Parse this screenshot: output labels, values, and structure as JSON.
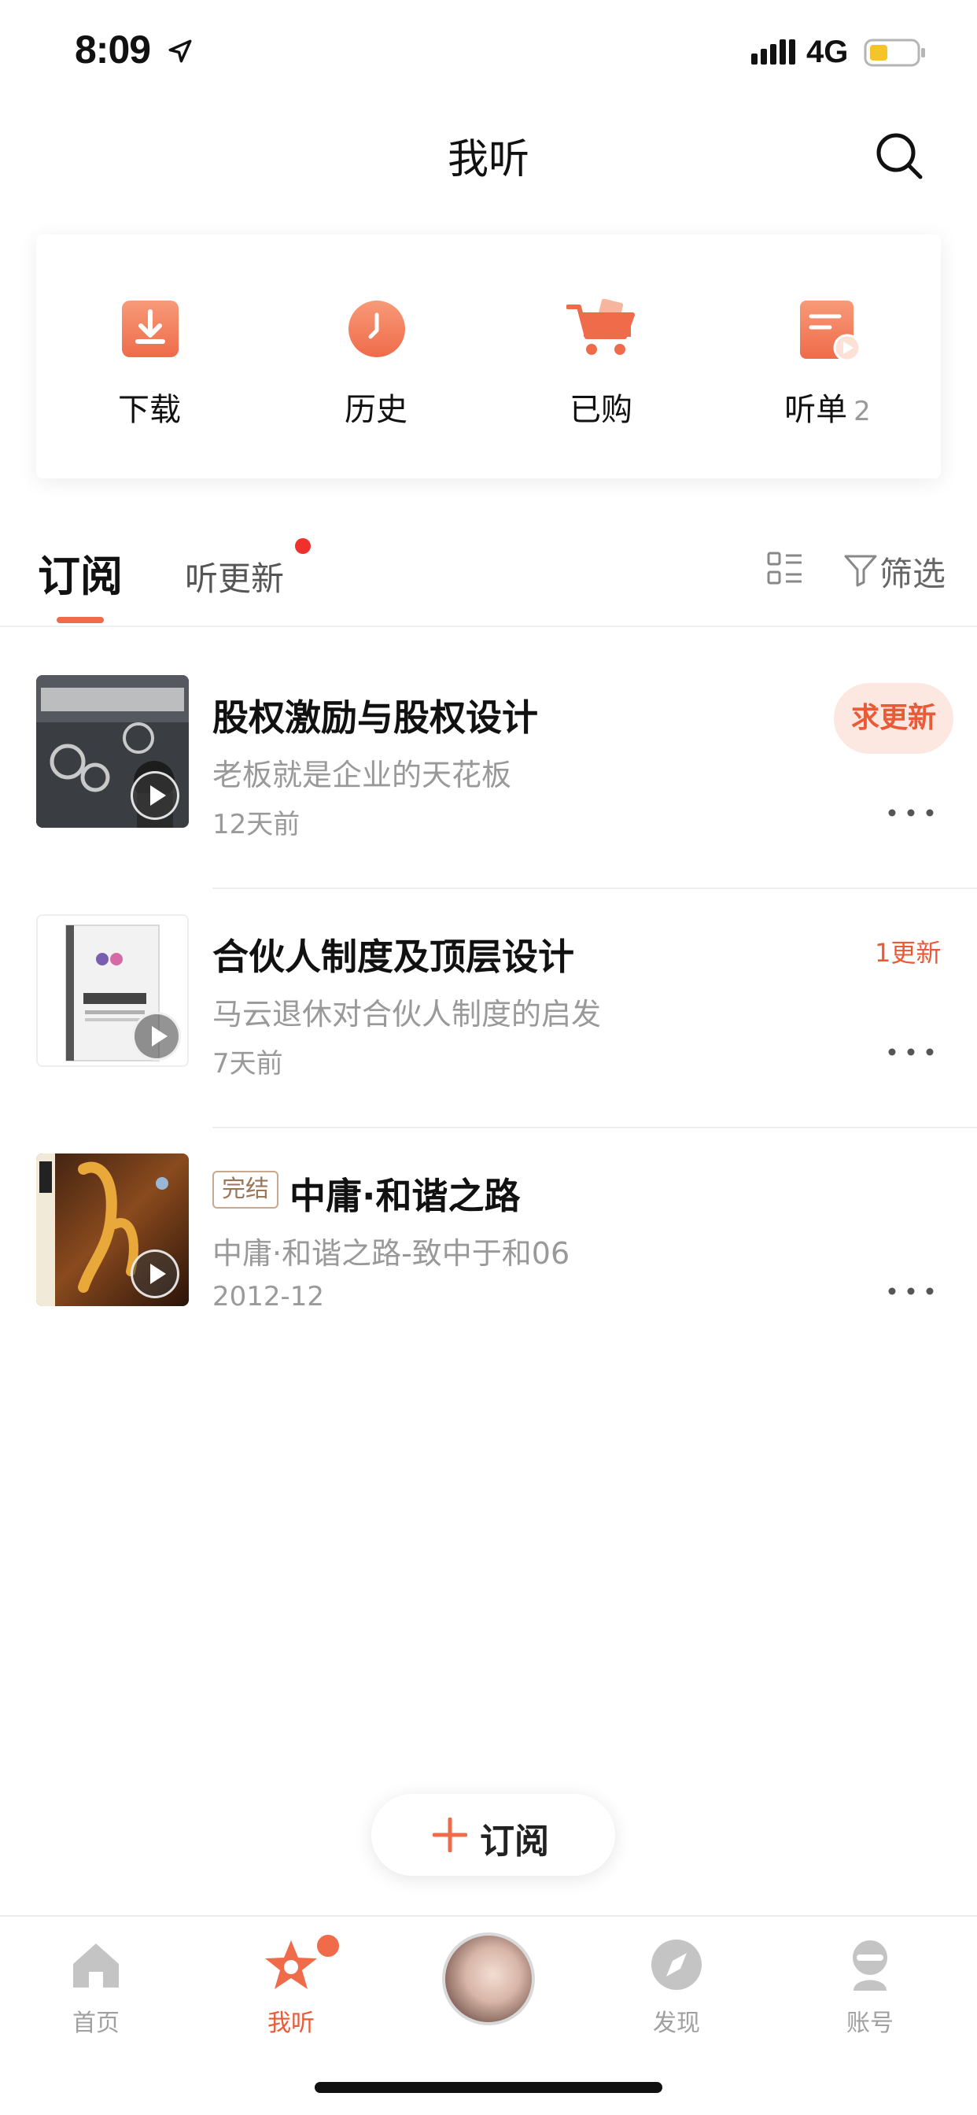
{
  "status_bar": {
    "time": "8:09",
    "network": "4G"
  },
  "nav": {
    "title": "我听"
  },
  "quick_actions": [
    {
      "label": "下载",
      "icon": "download-icon"
    },
    {
      "label": "历史",
      "icon": "clock-icon"
    },
    {
      "label": "已购",
      "icon": "cart-icon"
    },
    {
      "label": "听单",
      "count": "2",
      "icon": "playlist-icon"
    }
  ],
  "tabs": {
    "subscribe": "订阅",
    "updates": "听更新",
    "filter": "筛选"
  },
  "items": [
    {
      "title": "股权激励与股权设计",
      "subtitle": "老板就是企业的天花板",
      "date": "12天前",
      "action": "求更新"
    },
    {
      "title": "合伙人制度及顶层设计",
      "subtitle": "马云退休对合伙人制度的启发",
      "date": "7天前",
      "update_count": "1更新"
    },
    {
      "title": "中庸·和谐之路",
      "badge": "完结",
      "subtitle": "中庸·和谐之路-致中于和06",
      "date": "2012-12"
    }
  ],
  "subscribe_button": "订阅",
  "tabbar": {
    "home": "首页",
    "mine": "我听",
    "discover": "发现",
    "account": "账号"
  },
  "colors": {
    "accent": "#ea5a36",
    "accent_light": "#fde8e1",
    "text_secondary": "#999999"
  }
}
